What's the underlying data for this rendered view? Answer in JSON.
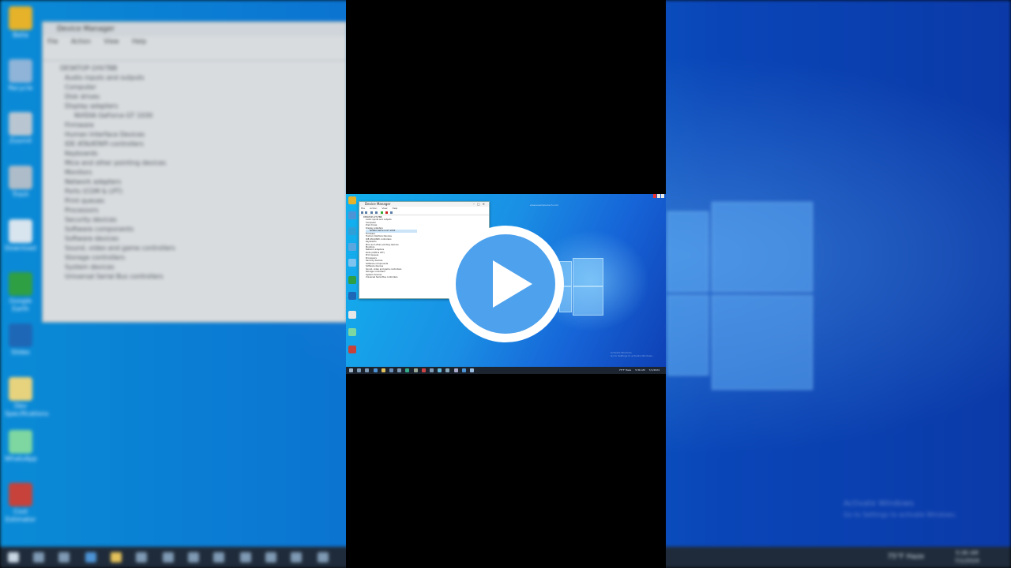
{
  "background": {
    "desktop_icons": [
      {
        "label": "Bella",
        "color": "#e5b22a"
      },
      {
        "label": "Recycle",
        "color": "#8fb4d8"
      },
      {
        "label": "Zoomit",
        "color": "#b9c6d2"
      },
      {
        "label": "Trash",
        "color": "#aebcc9"
      },
      {
        "label": "Download",
        "color": "#d8e4ee"
      },
      {
        "label": "Google Earth",
        "color": "#2f9f43"
      },
      {
        "label": "Slides",
        "color": "#1e67b6"
      },
      {
        "label": "Dev Specifications",
        "color": "#e7d37e"
      },
      {
        "label": "WhatsApp",
        "color": "#7ed7a1"
      },
      {
        "label": "Cost Estimator",
        "color": "#c7423a"
      }
    ],
    "device_manager": {
      "title": "Device Manager",
      "menu": [
        "File",
        "Action",
        "View",
        "Help"
      ],
      "root": "DESKTOP-1HV7BB",
      "nodes": [
        "Audio inputs and outputs",
        "Computer",
        "Disk drives",
        "Display adapters",
        "NVIDIA GeForce GT 1030",
        "Firmware",
        "Human Interface Devices",
        "IDE ATA/ATAPI controllers",
        "Keyboards",
        "Mice and other pointing devices",
        "Monitors",
        "Network adapters",
        "Ports (COM & LPT)",
        "Print queues",
        "Processors",
        "Security devices",
        "Software components",
        "Software devices",
        "Sound, video and game controllers",
        "Storage controllers",
        "System devices",
        "Universal Serial Bus controllers"
      ]
    },
    "tray": {
      "weather": "75°F Haze",
      "time": "5:36 AM",
      "date": "7/1/2024"
    },
    "activate": {
      "title": "Activate Windows",
      "subtitle": "Go to Settings to activate Windows."
    }
  },
  "thumbnail": {
    "watermark": "www.example-tech.com",
    "device_manager": {
      "title": "Device Manager",
      "menu": [
        "File",
        "Action",
        "View",
        "Help"
      ],
      "root": "DESKTOP-1HV7BB",
      "nodes": [
        "Audio inputs and outputs",
        "Computer",
        "Disk drives",
        "Display adapters",
        "NVIDIA GeForce GT 1030",
        "Firmware",
        "Human Interface Devices",
        "IDE ATA/ATAPI controllers",
        "Keyboards",
        "Mice and other pointing devices",
        "Monitors",
        "Network adapters",
        "Ports (COM & LPT)",
        "Print queues",
        "Processors",
        "Security devices",
        "Software components",
        "Software devices",
        "Sound, video and game controllers",
        "Storage controllers",
        "System devices",
        "Universal Serial Bus controllers"
      ]
    },
    "tray": {
      "weather": "75°F Haze",
      "time": "5:36 AM",
      "date": "7/1/2024"
    },
    "activate": {
      "title": "Activate Windows",
      "subtitle": "Go to Settings to activate Windows."
    }
  },
  "player": {
    "play_icon": "play-icon",
    "accent": "#4ea1ec"
  }
}
